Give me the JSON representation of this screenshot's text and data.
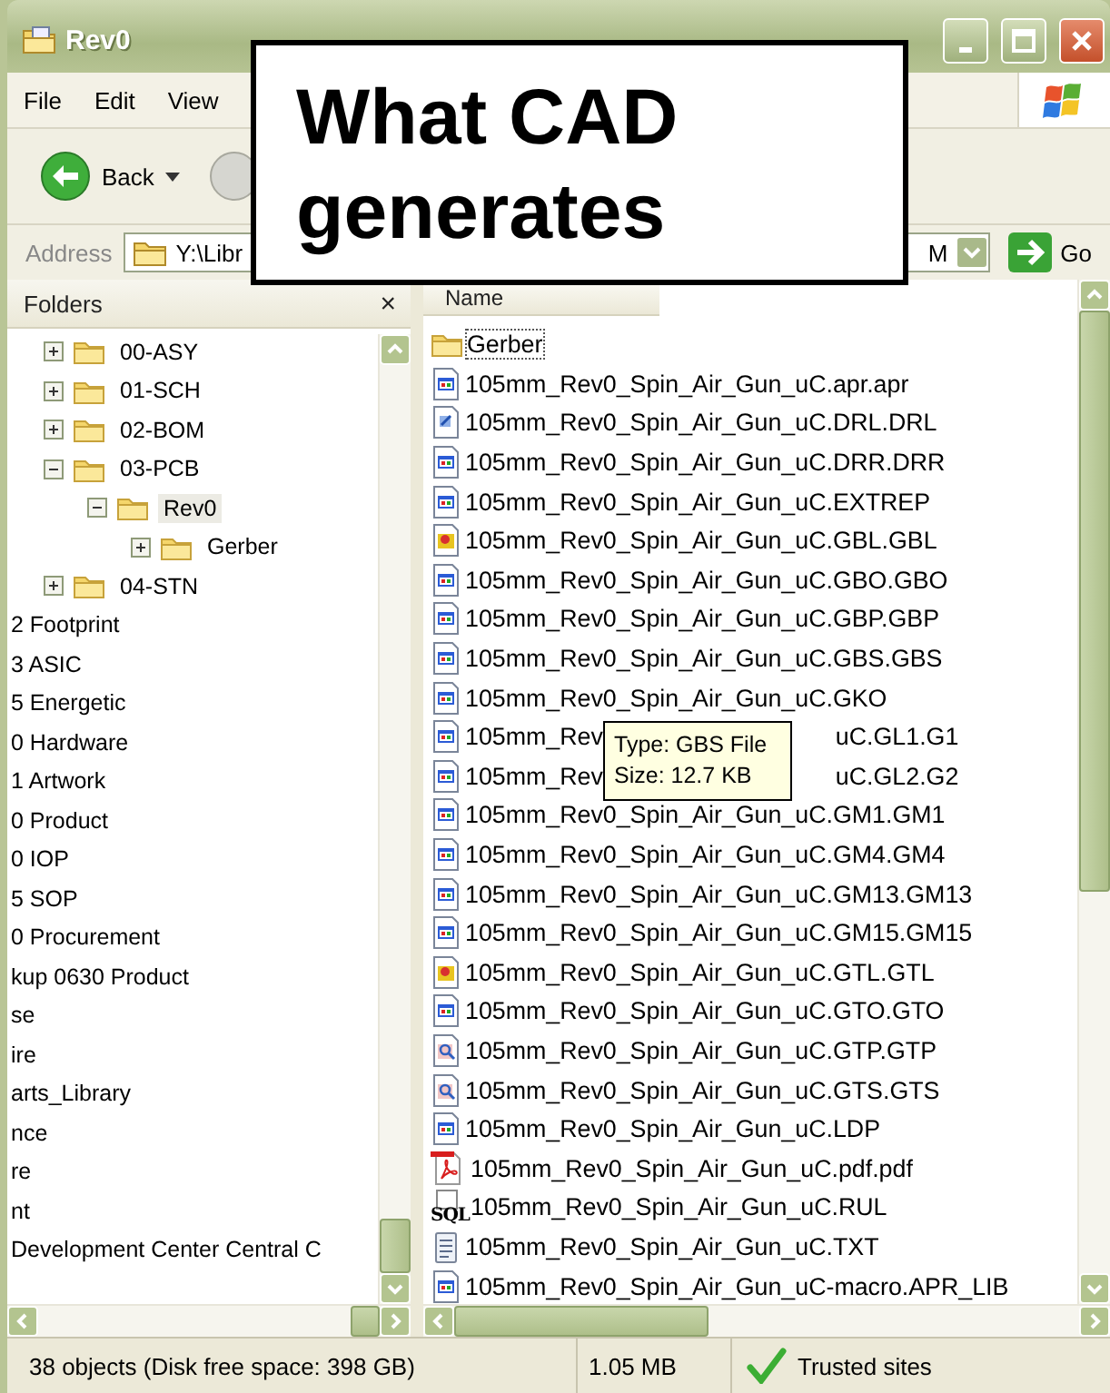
{
  "window": {
    "title": "Rev0"
  },
  "menu": [
    "File",
    "Edit",
    "View"
  ],
  "toolbar": {
    "back": "Back"
  },
  "address": {
    "label": "Address",
    "value_start": "Y:\\Libr",
    "value_end": "M",
    "go": "Go"
  },
  "callout": {
    "text": "What CAD generates"
  },
  "folders": {
    "title": "Folders",
    "close": "×",
    "items": [
      {
        "name": "00-ASY",
        "expanded": false,
        "selected": false
      },
      {
        "name": "01-SCH",
        "expanded": false,
        "selected": false
      },
      {
        "name": "02-BOM",
        "expanded": false,
        "selected": false
      },
      {
        "name": "03-PCB",
        "expanded": true,
        "selected": false,
        "children": [
          {
            "name": "Rev0",
            "expanded": true,
            "selected": true,
            "children": [
              {
                "name": "Gerber",
                "expanded": false,
                "selected": false
              }
            ]
          }
        ]
      },
      {
        "name": "04-STN",
        "expanded": false,
        "selected": false
      },
      {
        "name": "2 Footprint",
        "kind": "clipped"
      },
      {
        "name": "3 ASIC",
        "kind": "clipped"
      },
      {
        "name": "5 Energetic",
        "kind": "clipped"
      },
      {
        "name": "0 Hardware",
        "kind": "clipped"
      },
      {
        "name": "1 Artwork",
        "kind": "clipped"
      },
      {
        "name": "0 Product",
        "kind": "clipped"
      },
      {
        "name": "0 IOP",
        "kind": "clipped"
      },
      {
        "name": "5 SOP",
        "kind": "clipped"
      },
      {
        "name": "0 Procurement",
        "kind": "clipped"
      },
      {
        "name": "kup 0630 Product",
        "kind": "clipped"
      },
      {
        "name": "se",
        "kind": "clipped"
      },
      {
        "name": "ire",
        "kind": "clipped"
      },
      {
        "name": "arts_Library",
        "kind": "clipped"
      },
      {
        "name": "nce",
        "kind": "clipped"
      },
      {
        "name": "re",
        "kind": "clipped"
      },
      {
        "name": "nt",
        "kind": "clipped"
      },
      {
        "name": "Development Center Central C",
        "kind": "clipped"
      }
    ]
  },
  "files": {
    "columns": [
      "Name"
    ],
    "rows": [
      {
        "name": "Gerber",
        "kind": "folder",
        "focused": true
      },
      {
        "name": "105mm_Rev0_Spin_Air_Gun_uC.apr.apr",
        "kind": "app",
        "focused": false
      },
      {
        "name": "105mm_Rev0_Spin_Air_Gun_uC.DRL.DRL",
        "kind": "note",
        "focused": false
      },
      {
        "name": "105mm_Rev0_Spin_Air_Gun_uC.DRR.DRR",
        "kind": "app",
        "focused": false
      },
      {
        "name": "105mm_Rev0_Spin_Air_Gun_uC.EXTREP",
        "kind": "app",
        "focused": false
      },
      {
        "name": "105mm_Rev0_Spin_Air_Gun_uC.GBL.GBL",
        "kind": "board",
        "focused": false
      },
      {
        "name": "105mm_Rev0_Spin_Air_Gun_uC.GBO.GBO",
        "kind": "app",
        "focused": false
      },
      {
        "name": "105mm_Rev0_Spin_Air_Gun_uC.GBP.GBP",
        "kind": "app",
        "focused": false
      },
      {
        "name": "105mm_Rev0_Spin_Air_Gun_uC.GBS.GBS",
        "kind": "app",
        "focused": false
      },
      {
        "name": "105mm_Rev0_Spin_Air_Gun_uC.GKO",
        "kind": "app",
        "focused": false
      },
      {
        "name": "105mm_Rev",
        "name_end": "uC.GL1.G1",
        "kind": "app",
        "focused": false
      },
      {
        "name": "105mm_Rev",
        "name_end": "uC.GL2.G2",
        "kind": "app",
        "focused": false
      },
      {
        "name": "105mm_Rev0_Spin_Air_Gun_uC.GM1.GM1",
        "kind": "app",
        "focused": false
      },
      {
        "name": "105mm_Rev0_Spin_Air_Gun_uC.GM4.GM4",
        "kind": "app",
        "focused": false
      },
      {
        "name": "105mm_Rev0_Spin_Air_Gun_uC.GM13.GM13",
        "kind": "app",
        "focused": false
      },
      {
        "name": "105mm_Rev0_Spin_Air_Gun_uC.GM15.GM15",
        "kind": "app",
        "focused": false
      },
      {
        "name": "105mm_Rev0_Spin_Air_Gun_uC.GTL.GTL",
        "kind": "board",
        "focused": false
      },
      {
        "name": "105mm_Rev0_Spin_Air_Gun_uC.GTO.GTO",
        "kind": "app",
        "focused": false
      },
      {
        "name": "105mm_Rev0_Spin_Air_Gun_uC.GTP.GTP",
        "kind": "viewer",
        "focused": false
      },
      {
        "name": "105mm_Rev0_Spin_Air_Gun_uC.GTS.GTS",
        "kind": "viewer",
        "focused": false
      },
      {
        "name": "105mm_Rev0_Spin_Air_Gun_uC.LDP",
        "kind": "app",
        "focused": false
      },
      {
        "name": "105mm_Rev0_Spin_Air_Gun_uC.pdf.pdf",
        "kind": "pdf",
        "focused": false
      },
      {
        "name": "105mm_Rev0_Spin_Air_Gun_uC.RUL",
        "kind": "sql",
        "icon_text": "SQL",
        "focused": false
      },
      {
        "name": "105mm_Rev0_Spin_Air_Gun_uC.TXT",
        "kind": "text",
        "focused": false
      },
      {
        "name": "105mm_Rev0_Spin_Air_Gun_uC-macro.APR_LIB",
        "kind": "app",
        "focused": false
      }
    ]
  },
  "tooltip": {
    "lines": [
      "Type: GBS File",
      "Size: 12.7 KB"
    ]
  },
  "status_bar": {
    "objects": "38 objects (Disk free space: 398 GB)",
    "size": "1.05 MB",
    "zone": "Trusted sites"
  }
}
